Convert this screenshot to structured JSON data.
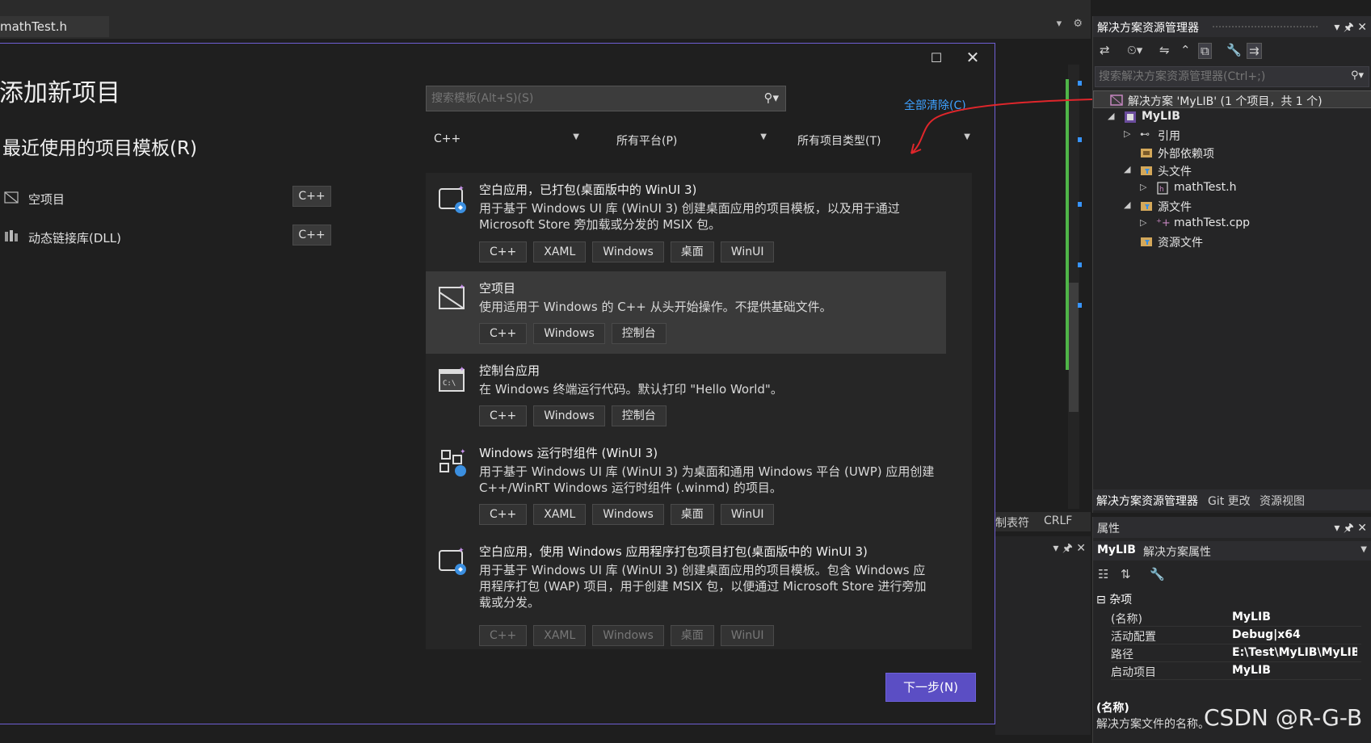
{
  "editor": {
    "tab_label": "mathTest.h",
    "status_encoding": "制表符",
    "status_eol": "CRLF"
  },
  "dialog": {
    "title": "添加新项目",
    "recent_title": "最近使用的项目模板(R)",
    "recent_items": [
      {
        "label": "空项目",
        "tag": "C++"
      },
      {
        "label": "动态链接库(DLL)",
        "tag": "C++"
      }
    ],
    "search_placeholder": "搜索模板(Alt+S)(S)",
    "clear_all": "全部清除(C)",
    "filters": {
      "language": "C++",
      "platform": "所有平台(P)",
      "project_type": "所有项目类型(T)"
    },
    "templates": [
      {
        "title": "空白应用，已打包(桌面版中的 WinUI 3)",
        "desc": "用于基于 Windows UI 库 (WinUI 3) 创建桌面应用的项目模板，以及用于通过 Microsoft Store 旁加载或分发的 MSIX 包。",
        "tags": [
          "C++",
          "XAML",
          "Windows",
          "桌面",
          "WinUI"
        ]
      },
      {
        "title": "空项目",
        "desc": "使用适用于 Windows 的 C++ 从头开始操作。不提供基础文件。",
        "tags": [
          "C++",
          "Windows",
          "控制台"
        ]
      },
      {
        "title": "控制台应用",
        "desc": "在 Windows 终端运行代码。默认打印 \"Hello World\"。",
        "tags": [
          "C++",
          "Windows",
          "控制台"
        ]
      },
      {
        "title": "Windows 运行时组件 (WinUI 3)",
        "desc": "用于基于 Windows UI 库 (WinUI 3) 为桌面和通用 Windows 平台 (UWP) 应用创建 C++/WinRT Windows 运行时组件 (.winmd) 的项目。",
        "tags": [
          "C++",
          "XAML",
          "Windows",
          "桌面",
          "WinUI"
        ]
      },
      {
        "title": "空白应用，使用 Windows 应用程序打包项目打包(桌面版中的 WinUI 3)",
        "desc": "用于基于 Windows UI 库 (WinUI 3) 创建桌面应用的项目模板。包含 Windows 应用程序打包 (WAP) 项目，用于创建 MSIX 包，以便通过 Microsoft Store 进行旁加载或分发。",
        "tags": [
          "C++",
          "XAML",
          "Windows",
          "桌面",
          "WinUI"
        ]
      }
    ],
    "next_button": "下一步(N)"
  },
  "solution_explorer": {
    "title": "解决方案资源管理器",
    "search_placeholder": "搜索解决方案资源管理器(Ctrl+;)",
    "tree": {
      "solution": "解决方案 'MyLIB' (1 个项目，共 1 个)",
      "project": "MyLIB",
      "references": "引用",
      "external_deps": "外部依赖项",
      "headers": "头文件",
      "header_file": "mathTest.h",
      "sources": "源文件",
      "source_file": "mathTest.cpp",
      "resources": "资源文件"
    },
    "tabs": [
      "解决方案资源管理器",
      "Git 更改",
      "资源视图"
    ]
  },
  "properties": {
    "title": "属性",
    "object_name": "MyLIB",
    "object_type": "解决方案属性",
    "category": "杂项",
    "rows": [
      {
        "key": "(名称)",
        "value": "MyLIB"
      },
      {
        "key": "活动配置",
        "value": "Debug|x64"
      },
      {
        "key": "路径",
        "value": "E:\\Test\\MyLIB\\MyLIB"
      },
      {
        "key": "启动项目",
        "value": "MyLIB"
      }
    ],
    "desc_title": "(名称)",
    "desc_text": "解决方案文件的名称。"
  },
  "watermark": "CSDN @R-G-B",
  "colors": {
    "accent": "#5b4ec4",
    "link": "#3ea1ff",
    "annotation": "#e0262b"
  }
}
